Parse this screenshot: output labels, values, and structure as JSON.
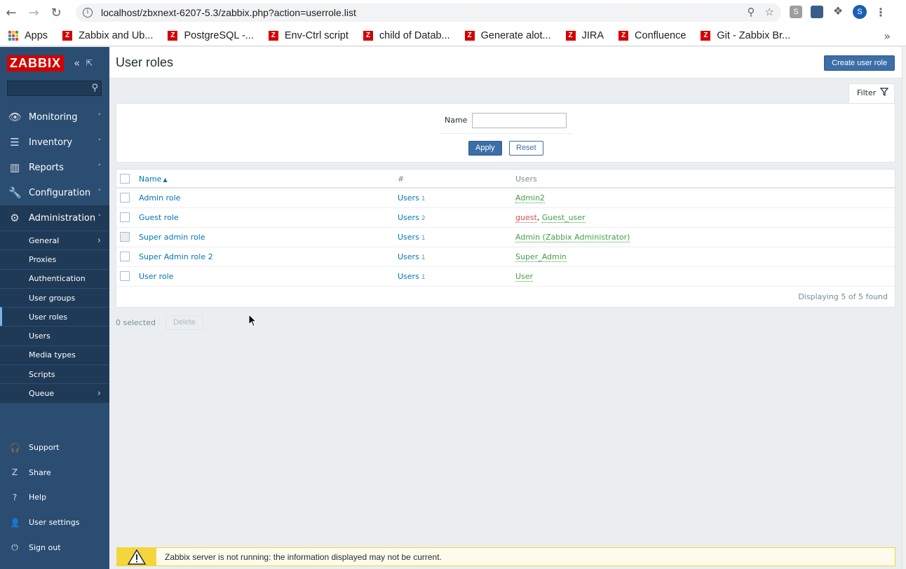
{
  "browser": {
    "url": "localhost/zbxnext-6207-5.3/zabbix.php?action=userrole.list",
    "profile_initial": "S",
    "ext_s": "S",
    "bookmarks": [
      {
        "label": "Apps",
        "type": "apps"
      },
      {
        "label": "Zabbix and Ub...",
        "type": "zabbix-red"
      },
      {
        "label": "PostgreSQL -...",
        "type": "zabbix-red"
      },
      {
        "label": "Env-Ctrl script",
        "type": "z"
      },
      {
        "label": "child of Datab...",
        "type": "zabbix-red"
      },
      {
        "label": "Generate alot...",
        "type": "z"
      },
      {
        "label": "JIRA",
        "type": "z"
      },
      {
        "label": "Confluence",
        "type": "zabbix-red"
      },
      {
        "label": "Git - Zabbix Br...",
        "type": "zabbix-red"
      }
    ]
  },
  "sidebar": {
    "logo": "ZABBIX",
    "menu": [
      {
        "label": "Monitoring",
        "icon": "eye-icon",
        "glyph": "👁"
      },
      {
        "label": "Inventory",
        "icon": "list-icon",
        "glyph": "☰"
      },
      {
        "label": "Reports",
        "icon": "bar-chart-icon",
        "glyph": "▥"
      },
      {
        "label": "Configuration",
        "icon": "wrench-icon",
        "glyph": "🔧"
      },
      {
        "label": "Administration",
        "icon": "gear-icon",
        "glyph": "⚙"
      }
    ],
    "admin_submenu": [
      {
        "label": "General",
        "has_arrow": true
      },
      {
        "label": "Proxies"
      },
      {
        "label": "Authentication"
      },
      {
        "label": "User groups"
      },
      {
        "label": "User roles",
        "active": true
      },
      {
        "label": "Users"
      },
      {
        "label": "Media types"
      },
      {
        "label": "Scripts"
      },
      {
        "label": "Queue",
        "has_arrow": true
      }
    ],
    "bottom": [
      {
        "label": "Support",
        "glyph": "🎧"
      },
      {
        "label": "Share",
        "glyph": "Z"
      },
      {
        "label": "Help",
        "glyph": "?"
      },
      {
        "label": "User settings",
        "glyph": "👤"
      },
      {
        "label": "Sign out",
        "glyph": "⏻"
      }
    ]
  },
  "page": {
    "title": "User roles",
    "create_button": "Create user role"
  },
  "filter": {
    "tab_label": "Filter",
    "name_label": "Name",
    "name_value": "",
    "apply": "Apply",
    "reset": "Reset"
  },
  "table": {
    "headers": {
      "name": "Name",
      "count": "#",
      "users": "Users"
    },
    "rows": [
      {
        "name": "Admin role",
        "users_link": "Users",
        "count": "1",
        "users": [
          {
            "name": "Admin2",
            "color": "green"
          }
        ],
        "disabled": false
      },
      {
        "name": "Guest role",
        "users_link": "Users",
        "count": "2",
        "users": [
          {
            "name": "guest",
            "color": "red"
          },
          {
            "name": "Guest_user",
            "color": "green"
          }
        ],
        "disabled": false
      },
      {
        "name": "Super admin role",
        "users_link": "Users",
        "count": "1",
        "users": [
          {
            "name": "Admin (Zabbix Administrator)",
            "color": "green"
          }
        ],
        "disabled": true
      },
      {
        "name": "Super Admin role 2",
        "users_link": "Users",
        "count": "1",
        "users": [
          {
            "name": "Super_Admin",
            "color": "green"
          }
        ],
        "disabled": false
      },
      {
        "name": "User role",
        "users_link": "Users",
        "count": "1",
        "users": [
          {
            "name": "User",
            "color": "green"
          }
        ],
        "disabled": false
      }
    ],
    "footer": "Displaying 5 of 5 found"
  },
  "actions": {
    "selected": "0 selected",
    "delete": "Delete"
  },
  "warning": {
    "text": "Zabbix server is not running: the information displayed may not be current."
  },
  "colors": {
    "sidebar": "#2b4d72",
    "accent": "#3c6ea8",
    "link": "#0275b8",
    "user_green": "#429e47",
    "user_red": "#d64e4e",
    "warning": "#f4d53b"
  }
}
